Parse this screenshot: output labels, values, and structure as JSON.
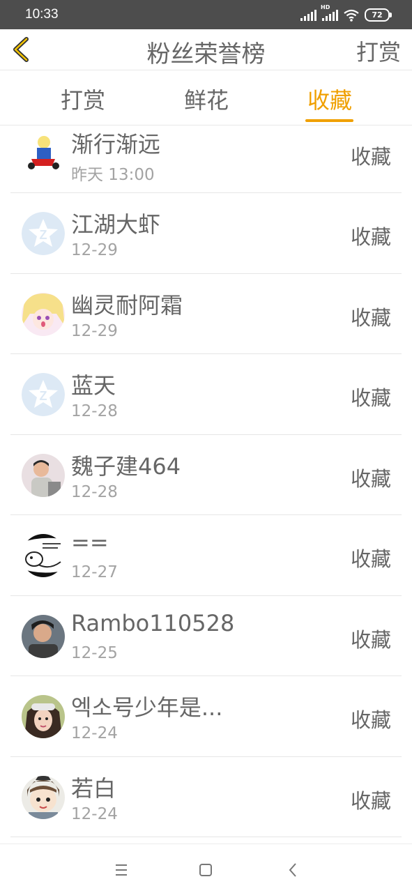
{
  "status_bar": {
    "time": "10:33",
    "battery": "72"
  },
  "header": {
    "title": "粉丝荣誉榜",
    "right_action": "打赏"
  },
  "tabs": [
    {
      "label": "打赏",
      "active": false
    },
    {
      "label": "鲜花",
      "active": false
    },
    {
      "label": "收藏",
      "active": true
    }
  ],
  "accent_color": "#f0a000",
  "fans": [
    {
      "name": "渐行渐远",
      "date": "昨天 13:00",
      "action": "收藏",
      "avatar": "cartoon-figure"
    },
    {
      "name": "江湖大虾",
      "date": "12-29",
      "action": "收藏",
      "avatar": "default-qq"
    },
    {
      "name": "幽灵耐阿霜",
      "date": "12-29",
      "action": "收藏",
      "avatar": "anime-girl"
    },
    {
      "name": "蓝天",
      "date": "12-28",
      "action": "收藏",
      "avatar": "default-qq"
    },
    {
      "name": "魏子建464",
      "date": "12-28",
      "action": "收藏",
      "avatar": "child-photo"
    },
    {
      "name": "==",
      "date": "12-27",
      "action": "收藏",
      "avatar": "comic-sketch"
    },
    {
      "name": "Rambo110528",
      "date": "12-25",
      "action": "收藏",
      "avatar": "man-photo"
    },
    {
      "name": "엑소号少年是...",
      "date": "12-24",
      "action": "收藏",
      "avatar": "girl-photo"
    },
    {
      "name": "若白",
      "date": "12-24",
      "action": "收藏",
      "avatar": "cartoon-boy"
    }
  ]
}
